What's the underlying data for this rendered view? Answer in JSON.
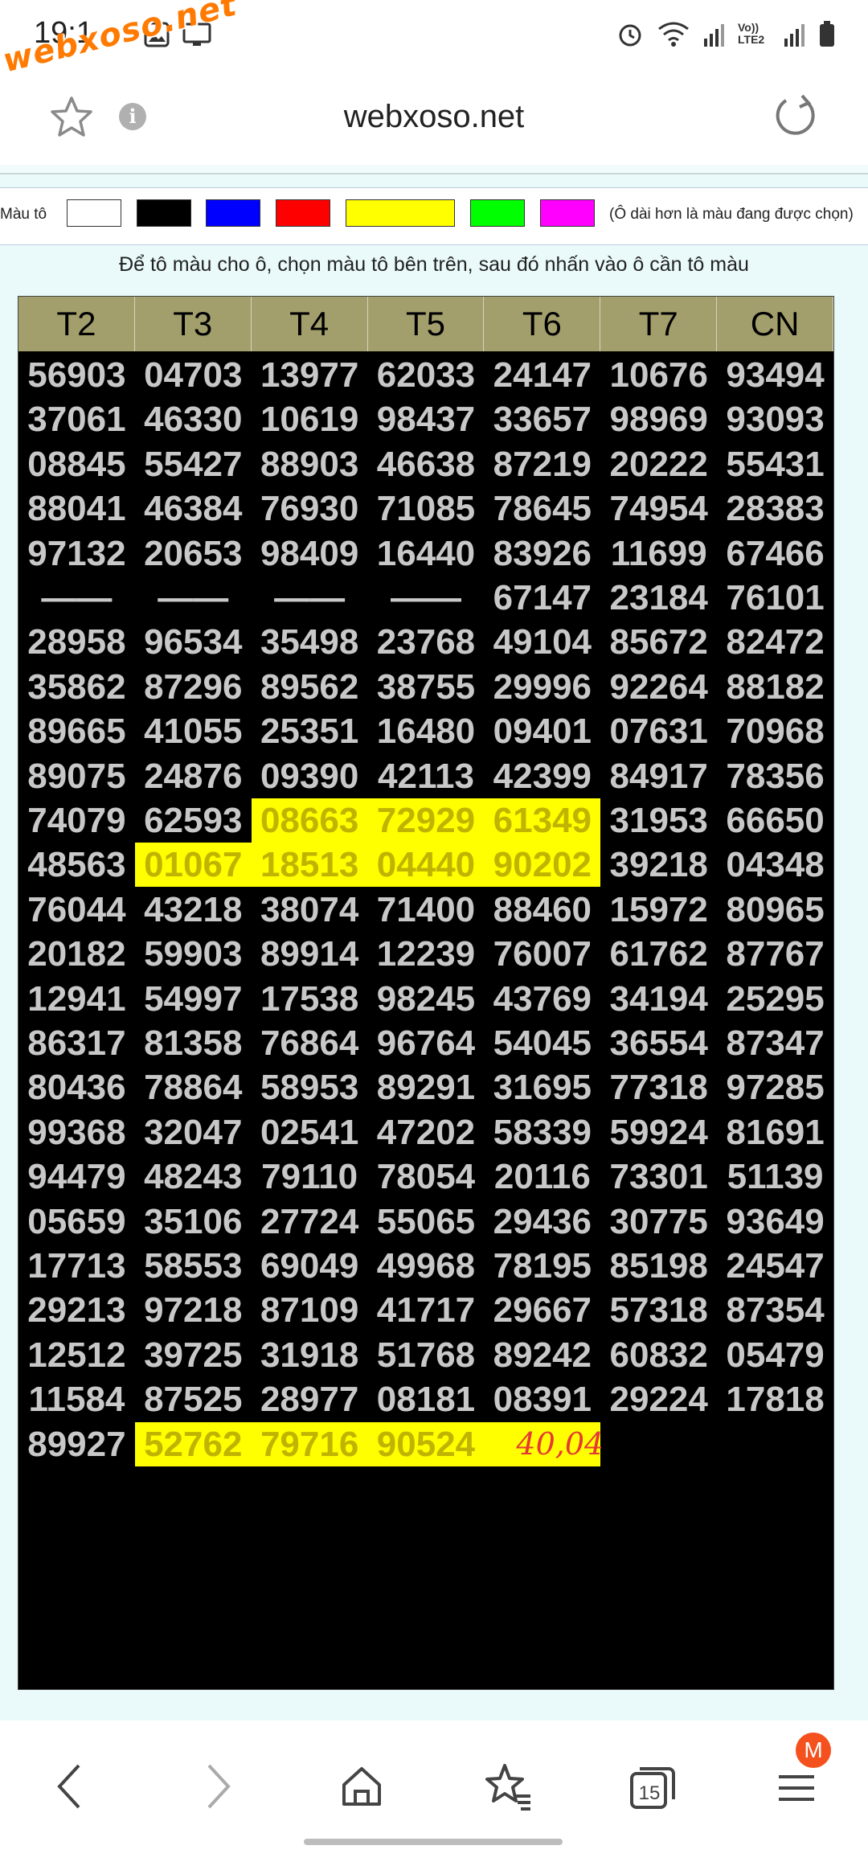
{
  "status": {
    "time": "19:1",
    "watermark": "webxoso.net",
    "network": "Vo)) LTE2"
  },
  "browser": {
    "title": "webxoso.net",
    "tabs_count": "15",
    "avatar_letter": "M"
  },
  "palette": {
    "label": "Màu tô",
    "colors": [
      "#ffffff",
      "#000000",
      "#0000ff",
      "#ff0000",
      "#ffff00",
      "#00ff00",
      "#ff00ff"
    ],
    "note": "(Ô dài hơn là màu đang được chọn)"
  },
  "instruction": "Để tô màu cho ô, chọn màu tô bên trên, sau đó nhấn vào ô cần tô màu",
  "table": {
    "headers": [
      "T2",
      "T3",
      "T4",
      "T5",
      "T6",
      "T7",
      "CN"
    ],
    "rows": [
      [
        "56903",
        "04703",
        "13977",
        "62033",
        "24147",
        "10676",
        "93494"
      ],
      [
        "37061",
        "46330",
        "10619",
        "98437",
        "33657",
        "98969",
        "93093"
      ],
      [
        "08845",
        "55427",
        "88903",
        "46638",
        "87219",
        "20222",
        "55431"
      ],
      [
        "88041",
        "46384",
        "76930",
        "71085",
        "78645",
        "74954",
        "28383"
      ],
      [
        "97132",
        "20653",
        "98409",
        "16440",
        "83926",
        "11699",
        "67466"
      ],
      [
        "——",
        "——",
        "——",
        "——",
        "67147",
        "23184",
        "76101"
      ],
      [
        "28958",
        "96534",
        "35498",
        "23768",
        "49104",
        "85672",
        "82472"
      ],
      [
        "35862",
        "87296",
        "89562",
        "38755",
        "29996",
        "92264",
        "88182"
      ],
      [
        "89665",
        "41055",
        "25351",
        "16480",
        "09401",
        "07631",
        "70968"
      ],
      [
        "89075",
        "24876",
        "09390",
        "42113",
        "42399",
        "84917",
        "78356"
      ],
      [
        "74079",
        "62593",
        "08663",
        "72929",
        "61349",
        "31953",
        "66650"
      ],
      [
        "48563",
        "01067",
        "18513",
        "04440",
        "90202",
        "39218",
        "04348"
      ],
      [
        "76044",
        "43218",
        "38074",
        "71400",
        "88460",
        "15972",
        "80965"
      ],
      [
        "20182",
        "59903",
        "89914",
        "12239",
        "76007",
        "61762",
        "87767"
      ],
      [
        "12941",
        "54997",
        "17538",
        "98245",
        "43769",
        "34194",
        "25295"
      ],
      [
        "86317",
        "81358",
        "76864",
        "96764",
        "54045",
        "36554",
        "87347"
      ],
      [
        "80436",
        "78864",
        "58953",
        "89291",
        "31695",
        "77318",
        "97285"
      ],
      [
        "99368",
        "32047",
        "02541",
        "47202",
        "58339",
        "59924",
        "81691"
      ],
      [
        "94479",
        "48243",
        "79110",
        "78054",
        "20116",
        "73301",
        "51139"
      ],
      [
        "05659",
        "35106",
        "27724",
        "55065",
        "29436",
        "30775",
        "93649"
      ],
      [
        "17713",
        "58553",
        "69049",
        "49968",
        "78195",
        "85198",
        "24547"
      ],
      [
        "29213",
        "97218",
        "87109",
        "41717",
        "29667",
        "57318",
        "87354"
      ],
      [
        "12512",
        "39725",
        "31918",
        "51768",
        "89242",
        "60832",
        "05479"
      ],
      [
        "11584",
        "87525",
        "28977",
        "08181",
        "08391",
        "29224",
        "17818"
      ],
      [
        "89927",
        "52762",
        "79716",
        "90524",
        "",
        "",
        ""
      ]
    ],
    "highlighted": [
      [
        10,
        2
      ],
      [
        10,
        3
      ],
      [
        10,
        4
      ],
      [
        11,
        1
      ],
      [
        11,
        2
      ],
      [
        11,
        3
      ],
      [
        11,
        4
      ],
      [
        24,
        1
      ],
      [
        24,
        2
      ],
      [
        24,
        3
      ],
      [
        24,
        4
      ]
    ],
    "highlight_color": "#ffff00",
    "handwritten_note": "40,04"
  }
}
